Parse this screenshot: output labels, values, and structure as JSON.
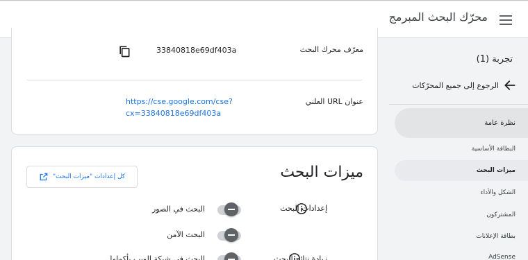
{
  "header": {
    "title": "محرّك البحث المبرمج",
    "menu_icon": "hamburger-menu-icon"
  },
  "sidebar": {
    "engine_name": "تجربة (1)",
    "back_label": "الرجوع إلى جميع المحرّكات",
    "items": [
      {
        "label": "نظرة عامة"
      },
      {
        "label": "البطاقة الأساسية"
      },
      {
        "label": "ميزات البحث"
      },
      {
        "label": "الشكل والأداء"
      },
      {
        "label": "المشتركون"
      },
      {
        "label": "بطاقة الإعلانات"
      },
      {
        "label": "AdSense"
      }
    ]
  },
  "engine_info": {
    "id_label": "معرّف محرك البحث",
    "id_value": "33840818e69df403a",
    "url_label": "عنوان URL العلني",
    "url_line1": "https://cse.google.com/cse?",
    "url_line2": "cx=33840818e69df403a"
  },
  "search_features": {
    "title": "ميزات البحث",
    "all_settings_label": "كل إعدادات \"ميزات البحث\"",
    "settings_label": "إعدادات البحث",
    "image_search_label": "البحث في الصور",
    "safe_search_label": "البحث الآمن",
    "enhance_label": "زيادة نتائج البحث",
    "web_search_label": "البحث في شبكة الويب بأكملها"
  },
  "colors": {
    "accent": "#1a73e8",
    "toggle_knob": "#5f6368",
    "toggle_track": "#cfd1d4"
  }
}
